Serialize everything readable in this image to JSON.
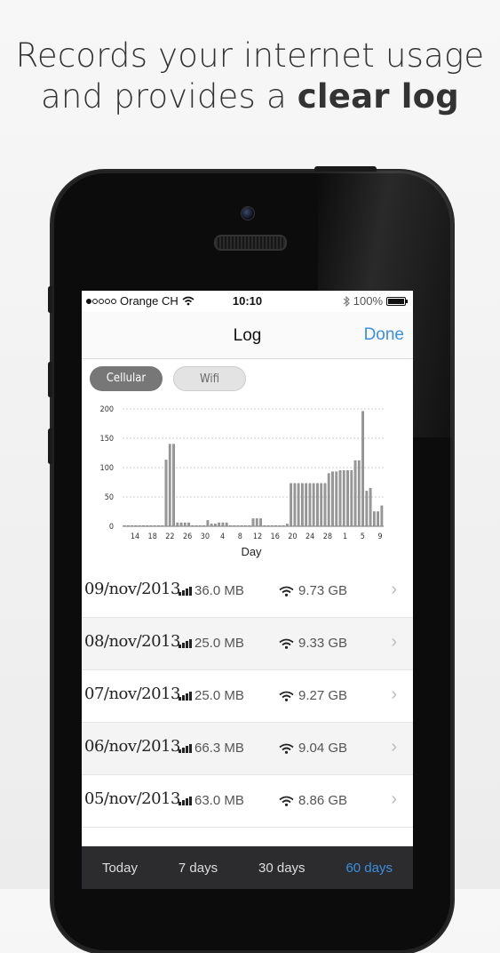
{
  "headline": {
    "line1": "Records your internet usage",
    "line2_regular": "and provides a ",
    "line2_bold": "clear log"
  },
  "status_bar": {
    "carrier": "Orange CH",
    "time": "10:10",
    "battery": "100%",
    "battery_level": 1.0,
    "signal_dots_filled": 1,
    "signal_dots_total": 5
  },
  "nav": {
    "title": "Log",
    "done_label": "Done"
  },
  "segments": {
    "cellular_label": "Cellular",
    "wifi_label": "Wifi",
    "selected": "Cellular"
  },
  "chart_data": {
    "type": "bar",
    "xlabel": "Day",
    "ylim": [
      0,
      200
    ],
    "yticks": [
      0,
      50,
      100,
      150,
      200
    ],
    "xtick_labels": [
      "14",
      "18",
      "22",
      "26",
      "30",
      "4",
      "8",
      "12",
      "16",
      "20",
      "24",
      "28",
      "1",
      "5",
      "9"
    ],
    "values": [
      0,
      0,
      0,
      0,
      0,
      0,
      0,
      0,
      0,
      0,
      0,
      113,
      140,
      140,
      6,
      6,
      6,
      6,
      0,
      0,
      0,
      0,
      10,
      4,
      4,
      6,
      6,
      6,
      0,
      0,
      0,
      0,
      0,
      0,
      13,
      13,
      13,
      0,
      0,
      0,
      0,
      0,
      0,
      4,
      73,
      73,
      73,
      73,
      73,
      73,
      73,
      73,
      73,
      73,
      90,
      93,
      93,
      95,
      95,
      95,
      95,
      112,
      112,
      196,
      60,
      65,
      25,
      25,
      35
    ],
    "grid": "horizontal dashed",
    "bar_color": "#999999"
  },
  "rows": [
    {
      "date": "09/nov/2013",
      "cellular": "36.0 MB",
      "wifi": "9.73 GB"
    },
    {
      "date": "08/nov/2013",
      "cellular": "25.0 MB",
      "wifi": "9.33 GB"
    },
    {
      "date": "07/nov/2013",
      "cellular": "25.0 MB",
      "wifi": "9.27 GB"
    },
    {
      "date": "06/nov/2013",
      "cellular": "66.3 MB",
      "wifi": "9.04 GB"
    },
    {
      "date": "05/nov/2013",
      "cellular": "63.0 MB",
      "wifi": "8.86 GB"
    }
  ],
  "tabs": [
    {
      "label": "Today",
      "active": false
    },
    {
      "label": "7 days",
      "active": false
    },
    {
      "label": "30 days",
      "active": false
    },
    {
      "label": "60 days",
      "active": true
    }
  ],
  "colors": {
    "accent": "#3b8fe0",
    "tab_bar": "#2c2c2e",
    "segment_selected": "#777777"
  },
  "icons": {
    "wifi": "wifi-icon",
    "bluetooth": "bluetooth-icon",
    "battery": "battery-icon",
    "signal": "signal-bars-icon",
    "chevron": "chevron-right-icon"
  }
}
